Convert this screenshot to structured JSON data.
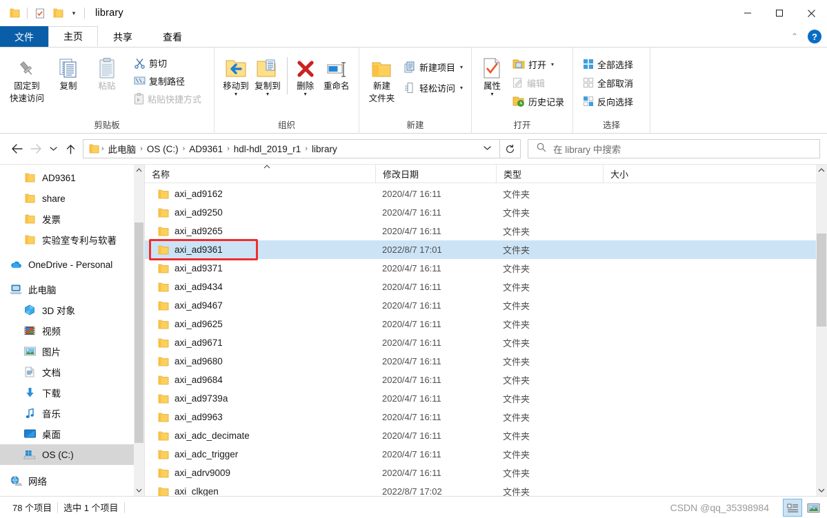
{
  "window": {
    "title": "library",
    "quick_access": [
      "folder-icon",
      "properties-icon",
      "new-folder-icon"
    ],
    "minimize": "minimize-icon",
    "maximize": "maximize-icon",
    "close": "close-icon"
  },
  "tabs": [
    {
      "label": "文件",
      "name": "tab-file"
    },
    {
      "label": "主页",
      "name": "tab-home"
    },
    {
      "label": "共享",
      "name": "tab-share"
    },
    {
      "label": "查看",
      "name": "tab-view"
    }
  ],
  "ribbon": {
    "help_label": "?",
    "groups": [
      {
        "title": "剪贴板",
        "big": [
          {
            "label1": "固定到",
            "label2": "快速访问",
            "icon": "pin-icon",
            "dim": false
          },
          {
            "label1": "复制",
            "label2": "",
            "icon": "copy-icon",
            "dim": false
          },
          {
            "label1": "粘贴",
            "label2": "",
            "icon": "paste-icon",
            "dim": true
          }
        ],
        "small": [
          {
            "label": "剪切",
            "icon": "scissors-icon",
            "dim": false
          },
          {
            "label": "复制路径",
            "icon": "copy-path-icon",
            "dim": false
          },
          {
            "label": "粘贴快捷方式",
            "icon": "paste-shortcut-icon",
            "dim": true
          }
        ]
      },
      {
        "title": "组织",
        "big": [
          {
            "label1": "移动到",
            "label2": "",
            "icon": "move-to-icon",
            "caret": true
          },
          {
            "label1": "复制到",
            "label2": "",
            "icon": "copy-to-icon",
            "caret": true
          },
          {
            "label1": "删除",
            "label2": "",
            "icon": "delete-icon",
            "caret": true
          },
          {
            "label1": "重命名",
            "label2": "",
            "icon": "rename-icon",
            "caret": false
          }
        ]
      },
      {
        "title": "新建",
        "big": [
          {
            "label1": "新建",
            "label2": "文件夹",
            "icon": "new-folder-icon",
            "caret": false
          }
        ],
        "small": [
          {
            "label": "新建项目",
            "icon": "new-item-icon",
            "caret": true
          },
          {
            "label": "轻松访问",
            "icon": "easy-access-icon",
            "caret": true
          }
        ]
      },
      {
        "title": "打开",
        "big": [
          {
            "label1": "属性",
            "label2": "",
            "icon": "properties-icon",
            "caret": true
          }
        ],
        "small": [
          {
            "label": "打开",
            "icon": "open-icon",
            "caret": true
          },
          {
            "label": "编辑",
            "icon": "edit-icon",
            "dim": true
          },
          {
            "label": "历史记录",
            "icon": "history-icon"
          }
        ]
      },
      {
        "title": "选择",
        "small": [
          {
            "label": "全部选择",
            "icon": "select-all-icon"
          },
          {
            "label": "全部取消",
            "icon": "select-none-icon",
            "dim": false
          },
          {
            "label": "反向选择",
            "icon": "invert-selection-icon"
          }
        ]
      }
    ]
  },
  "addressbar": {
    "back": "back-arrow-icon",
    "forward": "forward-arrow-icon",
    "recent": "recent-dropdown-icon",
    "up": "up-arrow-icon",
    "crumbs": [
      "此电脑",
      "OS (C:)",
      "AD9361",
      "hdl-hdl_2019_r1",
      "library"
    ],
    "separator": "›",
    "dropdown": "chevron-down-icon",
    "refresh": "refresh-icon"
  },
  "search": {
    "icon": "search-icon",
    "placeholder": "在 library 中搜索"
  },
  "sidebar": {
    "items": [
      {
        "label": "AD9361",
        "icon": "folder-icon",
        "indent": 1,
        "selected": false
      },
      {
        "label": "share",
        "icon": "folder-icon",
        "indent": 1,
        "selected": false
      },
      {
        "label": "发票",
        "icon": "folder-icon",
        "indent": 1,
        "selected": false
      },
      {
        "label": "实验室专利与软著",
        "icon": "folder-icon",
        "indent": 1,
        "selected": false
      },
      {
        "label": "OneDrive - Personal",
        "icon": "onedrive-icon",
        "indent": 0,
        "selected": false
      },
      {
        "label": "此电脑",
        "icon": "this-pc-icon",
        "indent": 0,
        "selected": false
      },
      {
        "label": "3D 对象",
        "icon": "3d-objects-icon",
        "indent": 1,
        "selected": false
      },
      {
        "label": "视频",
        "icon": "videos-icon",
        "indent": 1,
        "selected": false
      },
      {
        "label": "图片",
        "icon": "pictures-icon",
        "indent": 1,
        "selected": false
      },
      {
        "label": "文档",
        "icon": "documents-icon",
        "indent": 1,
        "selected": false
      },
      {
        "label": "下载",
        "icon": "downloads-icon",
        "indent": 1,
        "selected": false
      },
      {
        "label": "音乐",
        "icon": "music-icon",
        "indent": 1,
        "selected": false
      },
      {
        "label": "桌面",
        "icon": "desktop-icon",
        "indent": 1,
        "selected": false
      },
      {
        "label": "OS (C:)",
        "icon": "drive-icon",
        "indent": 1,
        "selected": true
      },
      {
        "label": "网络",
        "icon": "network-icon",
        "indent": 0,
        "selected": false
      }
    ]
  },
  "filelist": {
    "columns": [
      {
        "label": "名称",
        "key": "name"
      },
      {
        "label": "修改日期",
        "key": "date"
      },
      {
        "label": "类型",
        "key": "type"
      },
      {
        "label": "大小",
        "key": "size"
      }
    ],
    "sort_indicator": "sort-ascending-icon",
    "rows": [
      {
        "name": "axi_ad9162",
        "date": "2020/4/7 16:11",
        "type": "文件夹",
        "size": "",
        "selected": false
      },
      {
        "name": "axi_ad9250",
        "date": "2020/4/7 16:11",
        "type": "文件夹",
        "size": "",
        "selected": false
      },
      {
        "name": "axi_ad9265",
        "date": "2020/4/7 16:11",
        "type": "文件夹",
        "size": "",
        "selected": false
      },
      {
        "name": "axi_ad9361",
        "date": "2022/8/7 17:01",
        "type": "文件夹",
        "size": "",
        "selected": true
      },
      {
        "name": "axi_ad9371",
        "date": "2020/4/7 16:11",
        "type": "文件夹",
        "size": "",
        "selected": false
      },
      {
        "name": "axi_ad9434",
        "date": "2020/4/7 16:11",
        "type": "文件夹",
        "size": "",
        "selected": false
      },
      {
        "name": "axi_ad9467",
        "date": "2020/4/7 16:11",
        "type": "文件夹",
        "size": "",
        "selected": false
      },
      {
        "name": "axi_ad9625",
        "date": "2020/4/7 16:11",
        "type": "文件夹",
        "size": "",
        "selected": false
      },
      {
        "name": "axi_ad9671",
        "date": "2020/4/7 16:11",
        "type": "文件夹",
        "size": "",
        "selected": false
      },
      {
        "name": "axi_ad9680",
        "date": "2020/4/7 16:11",
        "type": "文件夹",
        "size": "",
        "selected": false
      },
      {
        "name": "axi_ad9684",
        "date": "2020/4/7 16:11",
        "type": "文件夹",
        "size": "",
        "selected": false
      },
      {
        "name": "axi_ad9739a",
        "date": "2020/4/7 16:11",
        "type": "文件夹",
        "size": "",
        "selected": false
      },
      {
        "name": "axi_ad9963",
        "date": "2020/4/7 16:11",
        "type": "文件夹",
        "size": "",
        "selected": false
      },
      {
        "name": "axi_adc_decimate",
        "date": "2020/4/7 16:11",
        "type": "文件夹",
        "size": "",
        "selected": false
      },
      {
        "name": "axi_adc_trigger",
        "date": "2020/4/7 16:11",
        "type": "文件夹",
        "size": "",
        "selected": false
      },
      {
        "name": "axi_adrv9009",
        "date": "2020/4/7 16:11",
        "type": "文件夹",
        "size": "",
        "selected": false
      },
      {
        "name": "axi_clkgen",
        "date": "2022/8/7 17:02",
        "type": "文件夹",
        "size": "",
        "selected": false
      }
    ]
  },
  "statusbar": {
    "item_count": "78 个项目",
    "selection": "选中 1 个项目",
    "watermark": "CSDN @qq_35398984",
    "view_details": "details-view-icon",
    "view_large_icons": "large-icons-view-icon"
  },
  "colors": {
    "accent": "#0a5ea8",
    "selection": "#cce3f5",
    "highlight_box": "#ef2d2d",
    "folder": "#ffca28"
  }
}
